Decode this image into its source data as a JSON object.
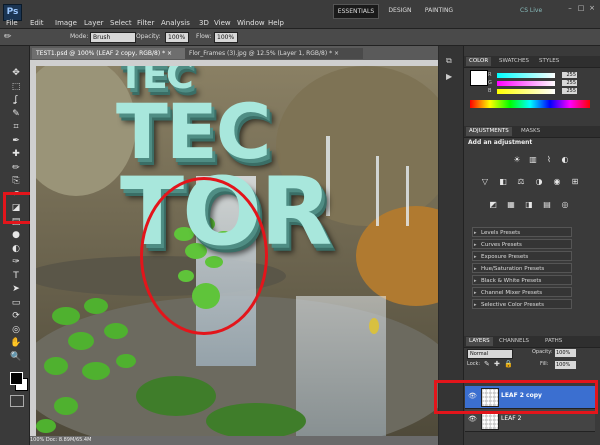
{
  "app": {
    "logo": "Ps",
    "menus": [
      "File",
      "Edit",
      "Image",
      "Layer",
      "Select",
      "Filter",
      "Analysis",
      "3D",
      "View",
      "Window",
      "Help"
    ],
    "workspaces": {
      "essentials": "ESSENTIALS",
      "design": "DESIGN",
      "painting": "PAINTING"
    },
    "cs_live": "CS Live",
    "window_controls": [
      "–",
      "□",
      "×"
    ]
  },
  "options_bar": {
    "mode_label": "Mode:",
    "mode_value": "Brush",
    "opacity_label": "Opacity:",
    "opacity_value": "100%",
    "flow_label": "Flow:",
    "flow_value": "100%"
  },
  "documents": {
    "tabs": [
      {
        "label": "TEST1.psd @ 100% (LEAF 2 copy, RGB/8) *",
        "close": "×"
      },
      {
        "label": "Flor_Frames (3).jpg @ 12.5% (Layer 1, RGB/8) *",
        "close": "×"
      }
    ],
    "status": "100%   Doc: 8.89M/65.4M"
  },
  "canvas_text": {
    "line1": "TEC",
    "line2": "TEC",
    "line3": "TOR"
  },
  "tools": [
    "move-icon",
    "marquee-icon",
    "lasso-icon",
    "quick-select-icon",
    "crop-icon",
    "eyedropper-icon",
    "healing-icon",
    "brush-icon",
    "clone-stamp-icon",
    "history-brush-icon",
    "eraser-icon",
    "gradient-icon",
    "blur-icon",
    "dodge-icon",
    "pen-icon",
    "type-icon",
    "path-select-icon",
    "shape-icon",
    "3d-rotate-icon",
    "3d-orbit-icon",
    "hand-icon",
    "zoom-icon"
  ],
  "tool_glyphs": [
    "✥",
    "⬚",
    "ʆ",
    "✎",
    "⌗",
    "✒",
    "✚",
    "✏",
    "⎘",
    "↶",
    "◪",
    "▤",
    "●",
    "◐",
    "✑",
    "T",
    "➤",
    "▭",
    "⟳",
    "◎",
    "✋",
    "🔍"
  ],
  "panels": {
    "color": {
      "tabs": [
        "COLOR",
        "SWATCHES",
        "STYLES"
      ],
      "values": [
        "255",
        "255",
        "255"
      ],
      "rgb_labels": [
        "R",
        "G",
        "B"
      ],
      "colors": {
        "r": "#ff3b30",
        "g": "#3ecf4f",
        "b": "#3a7bf0"
      }
    },
    "adjustments": {
      "tabs": [
        "ADJUSTMENTS",
        "MASKS"
      ],
      "header": "Add an adjustment",
      "presets": [
        "Levels Presets",
        "Curves Presets",
        "Exposure Presets",
        "Hue/Saturation Presets",
        "Black & White Presets",
        "Channel Mixer Presets",
        "Selective Color Presets"
      ]
    },
    "layers": {
      "tabs": [
        "LAYERS",
        "CHANNELS",
        "PATHS"
      ],
      "blend_mode": "Normal",
      "opacity_label": "Opacity:",
      "opacity_value": "100%",
      "lock_label": "Lock:",
      "fill_label": "Fill:",
      "fill_value": "100%",
      "rows": [
        {
          "name": "LEAF 2 copy",
          "selected": true
        },
        {
          "name": "LEAF 2",
          "selected": false
        }
      ],
      "eye_glyph": "👁"
    }
  },
  "accent": {
    "highlight": "#e3151b",
    "selection": "#3b6fd0"
  }
}
